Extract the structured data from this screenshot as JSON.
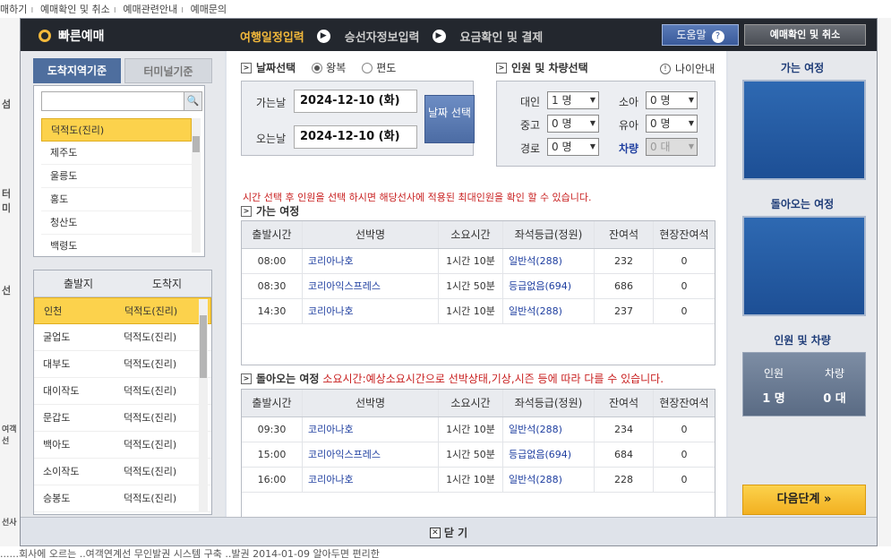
{
  "bg": {
    "top_links": [
      "매하기",
      "예매확인 및 취소",
      "예매관련안내",
      "예매문의"
    ],
    "left_fragments": [
      "섬",
      "터미",
      "선",
      "여객선",
      "선사"
    ],
    "bottom_text": "......회사에 오르는 ..여객연계선 무인발권 시스템 구축 ..발권         2014-01-09          알아두면 편리한"
  },
  "header": {
    "brand": "빠른예매",
    "steps": [
      "여행일정입력",
      "승선자정보입력",
      "요금확인 및 결제"
    ],
    "help_label": "도움말",
    "help_icon": "?",
    "confirm_label": "예매확인 및 취소"
  },
  "left": {
    "tabs": [
      "도착지역기준",
      "터미널기준"
    ],
    "search_placeholder": "",
    "regions": [
      "덕적도(진리)",
      "제주도",
      "울릉도",
      "홍도",
      "청산도",
      "백령도"
    ],
    "route_head": [
      "출발지",
      "도착지"
    ],
    "routes": [
      {
        "from": "인천",
        "to": "덕적도(진리)"
      },
      {
        "from": "굴업도",
        "to": "덕적도(진리)"
      },
      {
        "from": "대부도",
        "to": "덕적도(진리)"
      },
      {
        "from": "대이작도",
        "to": "덕적도(진리)"
      },
      {
        "from": "문갑도",
        "to": "덕적도(진리)"
      },
      {
        "from": "백아도",
        "to": "덕적도(진리)"
      },
      {
        "from": "소이작도",
        "to": "덕적도(진리)"
      },
      {
        "from": "승봉도",
        "to": "덕적도(진리)"
      }
    ]
  },
  "date": {
    "title": "날짜선택",
    "round_trip": "왕복",
    "one_way": "편도",
    "go_label": "가는날",
    "go_date": "2024-12-10 (화)",
    "return_label": "오는날",
    "return_date": "2024-12-10 (화)",
    "select_btn": "날짜 선택"
  },
  "pax": {
    "title": "인원 및 차량선택",
    "age_info": "나이안내",
    "adult": "대인",
    "adult_val": "1 명",
    "child": "소아",
    "child_val": "0 명",
    "senior": "중고",
    "senior_val": "0 명",
    "infant": "유아",
    "infant_val": "0 명",
    "elder": "경로",
    "elder_val": "0 명",
    "vehicle": "차량",
    "vehicle_val": "0 대"
  },
  "warning": "시간 선택 후 인원을 선택 하시면 해당선사에 적용된 최대인원을 확인 할 수 있습니다.",
  "table_head": [
    "출발시간",
    "선박명",
    "소요시간",
    "좌석등급(정원)",
    "잔여석",
    "현장잔여석"
  ],
  "outbound": {
    "title": "가는 여정",
    "rows": [
      [
        "08:00",
        "코리아나호",
        "1시간 10분",
        "일반석(288)",
        "232",
        "0"
      ],
      [
        "08:30",
        "코리아익스프레스",
        "1시간 50분",
        "등급없음(694)",
        "686",
        "0"
      ],
      [
        "14:30",
        "코리아나호",
        "1시간 10분",
        "일반석(288)",
        "237",
        "0"
      ]
    ]
  },
  "inbound": {
    "title": "돌아오는 여정",
    "note": "소요시간:예상소요시간으로 선박상태,기상,시즌 등에 따라 다를 수 있습니다.",
    "rows": [
      [
        "09:30",
        "코리아나호",
        "1시간 10분",
        "일반석(288)",
        "234",
        "0"
      ],
      [
        "15:00",
        "코리아익스프레스",
        "1시간 50분",
        "등급없음(694)",
        "684",
        "0"
      ],
      [
        "16:00",
        "코리아나호",
        "1시간 10분",
        "일반석(288)",
        "228",
        "0"
      ]
    ]
  },
  "right": {
    "go_title": "가는 여정",
    "return_title": "돌아오는 여정",
    "summary_title": "인원 및 차량",
    "people_label": "인원",
    "people_val": "1 명",
    "car_label": "차량",
    "car_val": "0 대",
    "next_btn": "다음단계"
  },
  "close_label": "닫 기"
}
